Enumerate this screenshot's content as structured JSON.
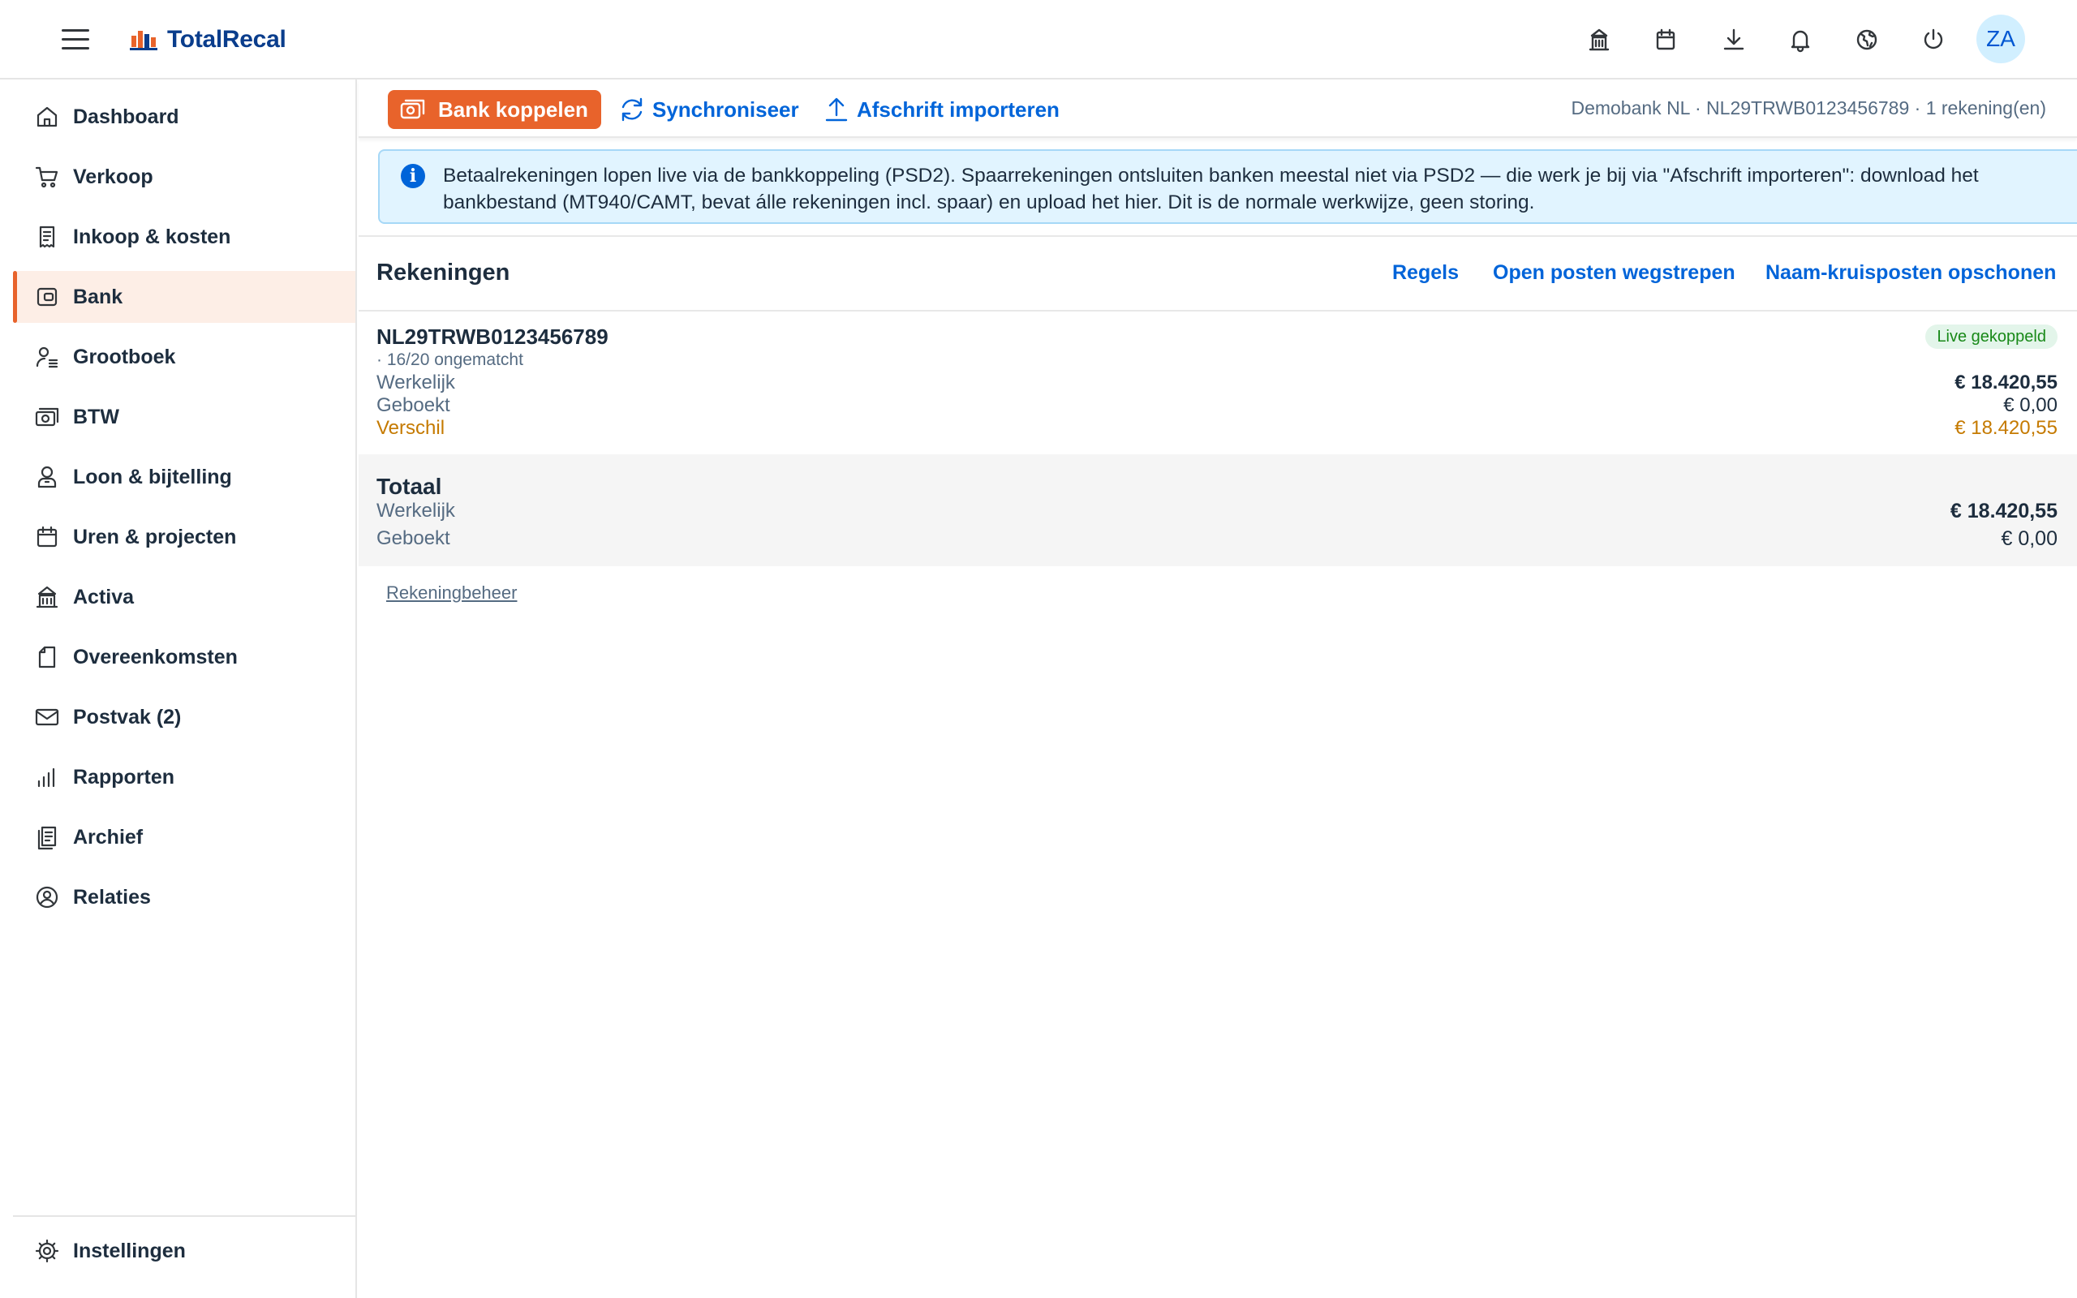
{
  "app": {
    "name": "TotalRecal",
    "user_initials": "ZA"
  },
  "topbar_icons": [
    "buildings-icon",
    "calendar-icon",
    "download-icon",
    "bell-icon",
    "globe-icon",
    "power-icon"
  ],
  "sidebar": {
    "items": [
      {
        "label": "Dashboard",
        "icon": "home-icon"
      },
      {
        "label": "Verkoop",
        "icon": "cart-icon"
      },
      {
        "label": "Inkoop & kosten",
        "icon": "receipt-icon"
      },
      {
        "label": "Bank",
        "icon": "wallet-icon",
        "active": true
      },
      {
        "label": "Grootboek",
        "icon": "ledger-icon"
      },
      {
        "label": "BTW",
        "icon": "money-icon"
      },
      {
        "label": "Loon & bijtelling",
        "icon": "employee-icon"
      },
      {
        "label": "Uren & projecten",
        "icon": "calendar-icon"
      },
      {
        "label": "Activa",
        "icon": "buildings-icon"
      },
      {
        "label": "Overeenkomsten",
        "icon": "document-icon"
      },
      {
        "label": "Postvak (2)",
        "icon": "mail-icon"
      },
      {
        "label": "Rapporten",
        "icon": "bar-chart-icon"
      },
      {
        "label": "Archief",
        "icon": "archive-icon"
      },
      {
        "label": "Relaties",
        "icon": "contact-icon"
      }
    ],
    "settings_label": "Instellingen"
  },
  "toolbar": {
    "connect_label": "Bank koppelen",
    "sync_label": "Synchroniseer",
    "import_label": "Afschrift importeren",
    "bank_info": "Demobank NL · NL29TRWB0123456789 · 1 rekening(en)"
  },
  "info_strip": {
    "text": "Betaalrekeningen lopen live via de bankkoppeling (PSD2). Spaarrekeningen ontsluiten banken meestal niet via PSD2 — die werk je bij via \"Afschrift importeren\": download het\nbankbestand (MT940/CAMT, bevat álle rekeningen incl. spaar) en upload het hier. Dit is de normale werkwijze, geen storing."
  },
  "accounts": {
    "title": "Rekeningen",
    "links": {
      "rules": "Regels",
      "clear_open": "Open posten wegstrepen",
      "cleanup": "Naam-kruisposten opschonen"
    },
    "account": {
      "iban": "NL29TRWB0123456789",
      "unmatched": "· 16/20 ongematcht",
      "status": "Live gekoppeld",
      "actual_label": "Werkelijk",
      "actual_value": "€ 18.420,55",
      "booked_label": "Geboekt",
      "booked_value": "€ 0,00",
      "diff_label": "Verschil",
      "diff_value": "€ 18.420,55"
    },
    "total": {
      "title": "Totaal",
      "actual_label": "Werkelijk",
      "actual_value": "€ 18.420,55",
      "booked_label": "Geboekt",
      "booked_value": "€ 0,00"
    },
    "manage_label": "Rekeningbeheer"
  },
  "colors": {
    "accent": "#e8632b",
    "link": "#0064d9",
    "warning": "#c57a00",
    "success": "#188918",
    "info_bg": "#e1f4ff"
  }
}
